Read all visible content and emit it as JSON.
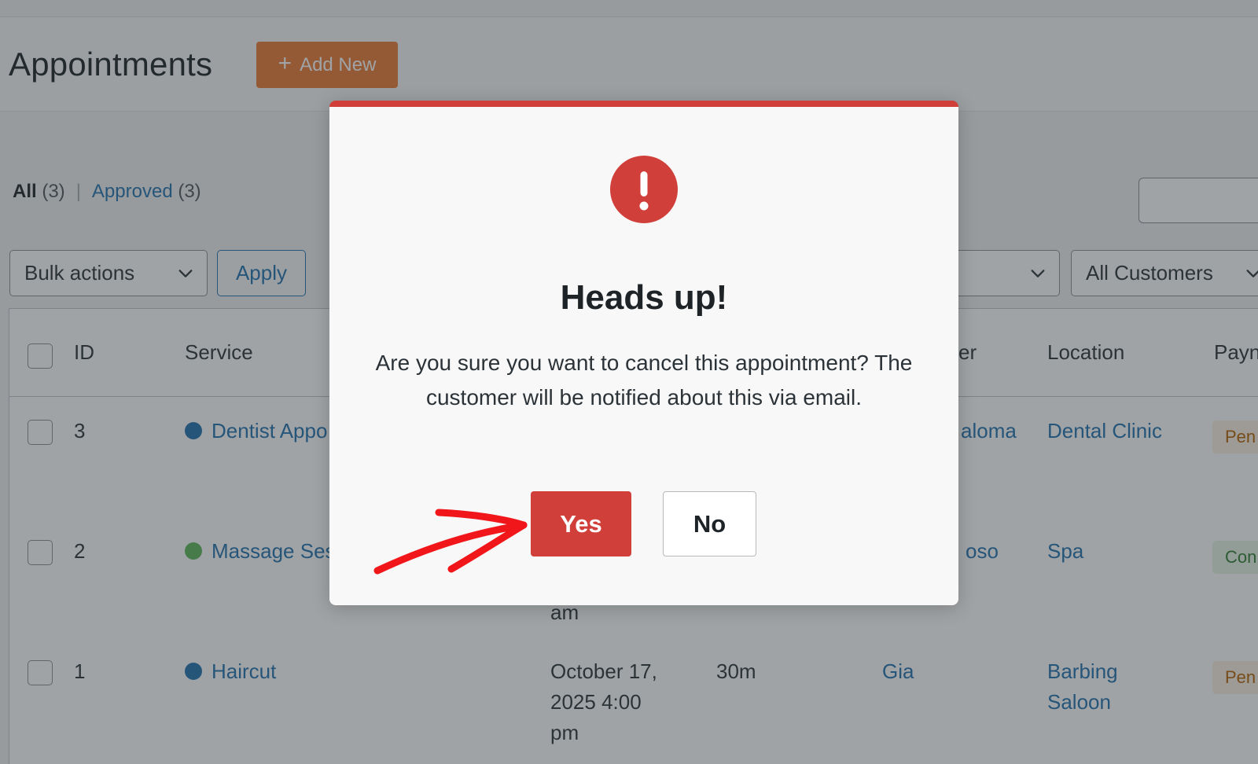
{
  "page": {
    "title": "Appointments",
    "add_new_label": "Add New",
    "filters": {
      "all_label": "All",
      "all_count": "(3)",
      "separator": "|",
      "approved_label": "Approved",
      "approved_count": "(3)"
    },
    "bulk_actions": {
      "selected": "Bulk actions"
    },
    "apply_label": "Apply",
    "customer_filter": {
      "selected": "All Customers"
    }
  },
  "table": {
    "columns": [
      "ID",
      "Service",
      "er",
      "Location",
      "Payn"
    ],
    "rows": [
      {
        "id": "3",
        "service": "Dentist Appo",
        "dot_color": "#2271b1",
        "date": "",
        "duration": "",
        "customer": "aloma",
        "location": "Dental Clinic",
        "payment": "Pen",
        "payment_style": "pending"
      },
      {
        "id": "2",
        "service": "Massage Ses",
        "dot_color": "#5fb65a",
        "date": "am",
        "duration": "",
        "customer": "oso",
        "location": "Spa",
        "payment": "Con",
        "payment_style": "completed"
      },
      {
        "id": "1",
        "service": "Haircut",
        "dot_color": "#2271b1",
        "date": "October 17, 2025 4:00 pm",
        "date_lines": [
          "October 17,",
          "2025 4:00",
          "pm"
        ],
        "duration": "30m",
        "customer": "Gia",
        "location": "Barbing Saloon",
        "location_lines": [
          "Barbing",
          "Saloon"
        ],
        "payment": "Pen",
        "payment_style": "pending"
      }
    ]
  },
  "modal": {
    "title": "Heads up!",
    "message": "Are you sure you want to cancel this appointment? The customer will be notified about this via email.",
    "yes_label": "Yes",
    "no_label": "No",
    "accent_color": "#d03f3a"
  },
  "icons": {
    "alert": "exclamation-circle-icon",
    "plus": "plus-icon",
    "chevron": "chevron-down-icon",
    "annotation": "red-arrow-icon"
  }
}
